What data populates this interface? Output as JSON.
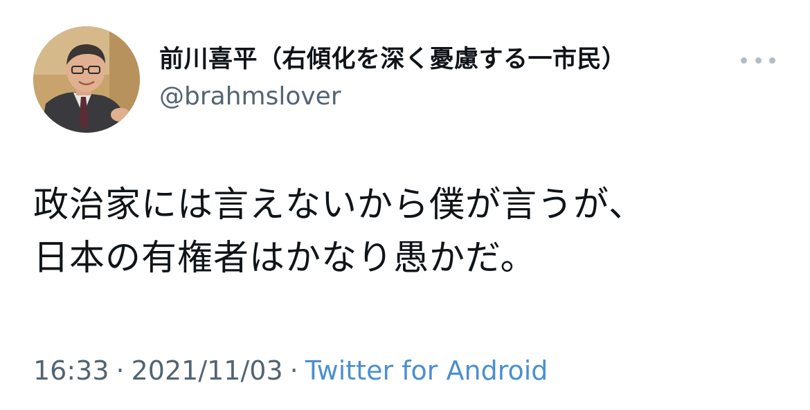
{
  "tweet": {
    "display_name": "前川喜平（右傾化を深く憂慮する一市民）",
    "handle": "@brahmslover",
    "text_line1": "政治家には言えないから僕が言うが、",
    "text_line2": "日本の有権者はかなり愚かだ。",
    "time": "16:33",
    "date": "2021/11/03",
    "separator": "·",
    "source": "Twitter for Android",
    "avatar_icon": "profile-photo-icon",
    "more_icon": "more-options-icon"
  },
  "colors": {
    "text": "#0f1419",
    "secondary": "#536471",
    "link": "#4a8fd1",
    "more_dots": "#b3bcc4"
  }
}
